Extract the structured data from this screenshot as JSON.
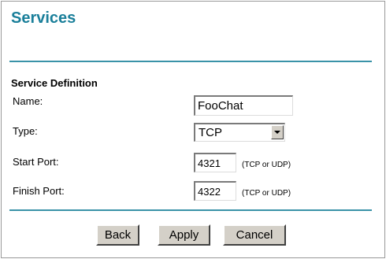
{
  "page": {
    "title": "Services",
    "section_label": "Service Definition",
    "accent_color": "#1a7f9a"
  },
  "form": {
    "name_label": "Name:",
    "name_value": "FooChat",
    "type_label": "Type:",
    "type_value": "TCP",
    "start_port_label": "Start Port:",
    "start_port_value": "4321",
    "start_port_hint": "(TCP or UDP)",
    "finish_port_label": "Finish Port:",
    "finish_port_value": "4322",
    "finish_port_hint": "(TCP or UDP)"
  },
  "buttons": {
    "back": "Back",
    "apply": "Apply",
    "cancel": "Cancel"
  },
  "icons": {
    "dropdown": "chevron-down-icon"
  }
}
